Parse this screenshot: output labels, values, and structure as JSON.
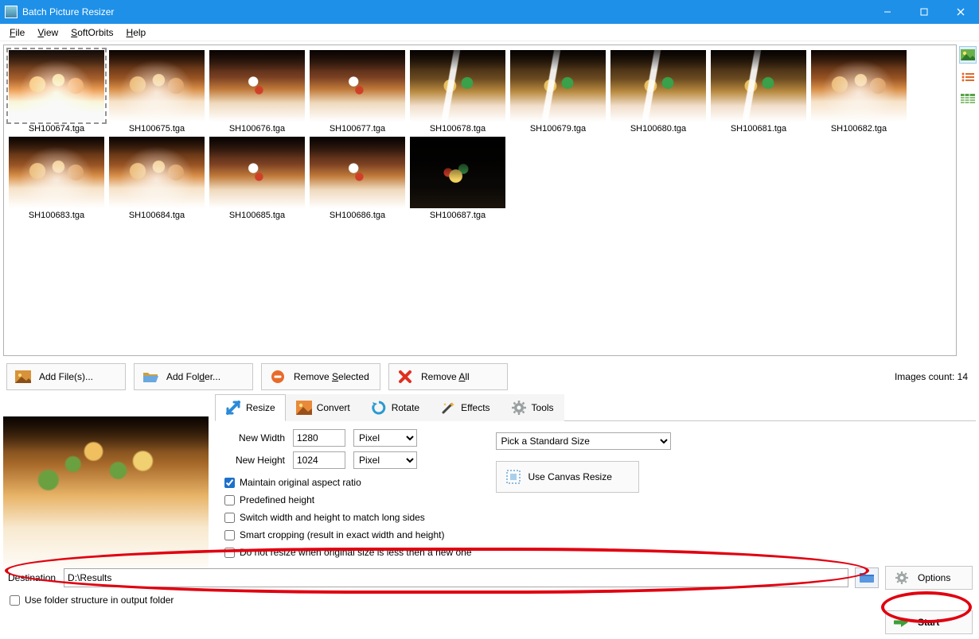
{
  "window": {
    "title": "Batch Picture Resizer"
  },
  "menubar": {
    "file": "File",
    "view": "View",
    "softorbits": "SoftOrbits",
    "help": "Help"
  },
  "sidebar": {
    "modes": [
      "thumbnails",
      "list",
      "details"
    ],
    "active": 0
  },
  "thumbnails": [
    {
      "label": "SH100674.tga",
      "variant": "",
      "selected": true
    },
    {
      "label": "SH100675.tga",
      "variant": ""
    },
    {
      "label": "SH100676.tga",
      "variant": "var2"
    },
    {
      "label": "SH100677.tga",
      "variant": "var2"
    },
    {
      "label": "SH100678.tga",
      "variant": "var3"
    },
    {
      "label": "SH100679.tga",
      "variant": "var3"
    },
    {
      "label": "SH100680.tga",
      "variant": "var3"
    },
    {
      "label": "SH100681.tga",
      "variant": "var3"
    },
    {
      "label": "SH100682.tga",
      "variant": ""
    },
    {
      "label": "SH100683.tga",
      "variant": ""
    },
    {
      "label": "SH100684.tga",
      "variant": ""
    },
    {
      "label": "SH100685.tga",
      "variant": "var2"
    },
    {
      "label": "SH100686.tga",
      "variant": "var2"
    },
    {
      "label": "SH100687.tga",
      "variant": "var4"
    }
  ],
  "actions": {
    "add_files": "Add File(s)...",
    "add_folder": "Add Folder...",
    "remove_selected": "Remove Selected",
    "remove_all": "Remove All",
    "images_count_label": "Images count: 14"
  },
  "tabs": {
    "resize": "Resize",
    "convert": "Convert",
    "rotate": "Rotate",
    "effects": "Effects",
    "tools": "Tools",
    "active": "resize"
  },
  "resize": {
    "new_width_label": "New Width",
    "new_width_value": "1280",
    "new_height_label": "New Height",
    "new_height_value": "1024",
    "unit_width": "Pixel",
    "unit_height": "Pixel",
    "pick_size": "Pick a Standard Size",
    "canvas_btn": "Use Canvas Resize",
    "chk_maintain": "Maintain original aspect ratio",
    "chk_predef": "Predefined height",
    "chk_switch": "Switch width and height to match long sides",
    "chk_smart": "Smart cropping (result in exact width and height)",
    "chk_noresize": "Do not resize when original size is less then a new one",
    "maintain_checked": true
  },
  "destination": {
    "label": "Destination",
    "value": "D:\\Results",
    "options": "Options",
    "folder_structure": "Use folder structure in output folder"
  },
  "start": {
    "label": "Start"
  }
}
